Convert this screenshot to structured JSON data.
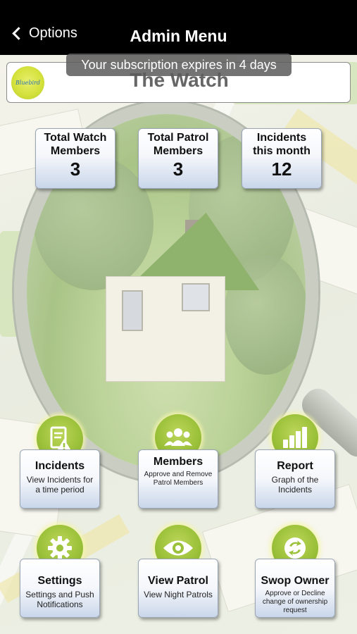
{
  "header": {
    "back_label": "Options",
    "title": "Admin Menu"
  },
  "watch": {
    "name": "The Watch",
    "logo_text": "Bluebird"
  },
  "toast": "Your subscription expires in 4 days",
  "stats": [
    {
      "label_line1": "Total Watch",
      "label_line2": "Members",
      "value": "3"
    },
    {
      "label_line1": "Total Patrol",
      "label_line2": "Members",
      "value": "3"
    },
    {
      "label_line1": "Incidents",
      "label_line2": "this month",
      "value": "12"
    }
  ],
  "tiles": [
    {
      "title": "Incidents",
      "subtitle": "View Incidents for a time period",
      "icon": "incident-report-icon"
    },
    {
      "title": "Members",
      "subtitle": "Approve and Remove Patrol Members",
      "icon": "members-group-icon"
    },
    {
      "title": "Report",
      "subtitle": "Graph of the Incidents",
      "icon": "bar-graph-icon"
    },
    {
      "title": "Settings",
      "subtitle": "Settings and Push Notifications",
      "icon": "gear-icon"
    },
    {
      "title": "View Patrol",
      "subtitle": "View Night Patrols",
      "icon": "eye-icon"
    },
    {
      "title": "Swop Owner",
      "subtitle": "Approve or Decline change of ownership request",
      "icon": "swap-arrows-icon"
    }
  ],
  "colors": {
    "topbar": "#000000",
    "icon_green": "#9cc13a",
    "card_blue": "#c9d6ea"
  }
}
